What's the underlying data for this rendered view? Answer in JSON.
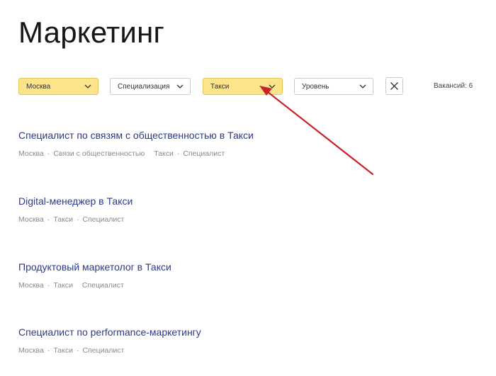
{
  "page": {
    "title": "Маркетинг"
  },
  "filters": {
    "city": "Москва",
    "specialization": "Специализация",
    "service": "Такси",
    "level": "Уровень"
  },
  "vacancies_count": "Вакансий: 6",
  "vacancies": [
    {
      "title": "Специалист по связям с общественностью в Такси",
      "tags": [
        "Москва",
        "Связи с общественностью",
        "Такси",
        "Специалист"
      ]
    },
    {
      "title": "Digital-менеджер в Такси",
      "tags": [
        "Москва",
        "Такси",
        "Специалист"
      ]
    },
    {
      "title": "Продуктовый маркетолог в Такси",
      "tags": [
        "Москва",
        "Такси",
        "Специалист"
      ]
    },
    {
      "title": "Специалист по performance-маркетингу",
      "tags": [
        "Москва",
        "Такси",
        "Специалист"
      ]
    }
  ],
  "colors": {
    "active_filter": "#fbe48a",
    "link": "#2b3a8c",
    "arrow": "#c8222a"
  },
  "icons": {
    "dropdown": "chevron-down-icon",
    "clear": "close-icon",
    "annotation": "arrow-icon"
  }
}
